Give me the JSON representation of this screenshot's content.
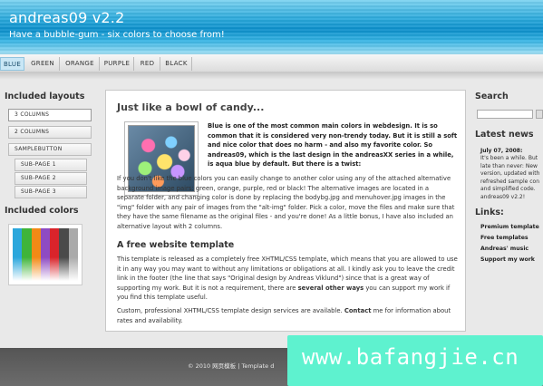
{
  "header": {
    "title": "andreas09 v2.2",
    "slogan": "Have a bubble-gum - six colors to choose from!"
  },
  "color_tabs": [
    "BLUE",
    "GREEN",
    "ORANGE",
    "PURPLE",
    "RED",
    "BLACK"
  ],
  "active_tab": "BLUE",
  "left": {
    "layouts_heading": "Included layouts",
    "nav": [
      "3 COLUMNS",
      "2 COLUMNS",
      "SAMPLEBUTTON",
      "SUB-PAGE 1",
      "SUB-PAGE 2",
      "SUB-PAGE 3"
    ],
    "colors_heading": "Included colors",
    "swatch_colors": [
      "#2ba7dc",
      "#3fb43a",
      "#f28a16",
      "#8e4bc2",
      "#d9242b",
      "#4a4a4a",
      "#aaaaaa"
    ]
  },
  "content": {
    "heading": "Just like a bowl of candy...",
    "intro": "Blue is one of the most common main colors in webdesign. It is so common that it is considered very non-trendy today. But it is still a soft and nice color that does no harm - and also my favorite color. So andreas09, which is the last design in the andreasXX series in a while, is aqua blue by default. But there is a twist:",
    "para1": "If you don't like the blue colors you can easily change to another color using any of the attached alternative background image pairs: green, orange, purple, red or black! The alternative images are located in a separate folder, and changing color is done by replacing the bodybg.jpg and menuhover.jpg images in the \"img\" folder with any pair of images from the \"alt-img\" folder. Pick a color, move the files and make sure that they have the same filename as the original files - and you're done! As a little bonus, I have also included an alternative layout with 2 columns.",
    "subheading": "A free website template",
    "para2a": "This template is released as a completely free XHTML/CSS template, which means that you are allowed to use it in any way you may want to without any limitations or obligations at all. I kindly ask you to leave the credit link in the footer (the line that says \"Original design by Andreas Viklund\") since that is a great way of supporting my work. But it is not a requirement, there are ",
    "para2_bold": "several other ways",
    "para2b": " you can support my work if you find this template useful.",
    "para3a": "Custom, professional XHTML/CSS template design services are available. ",
    "para3_bold": "Contact",
    "para3b": " me for information about rates and availability."
  },
  "right": {
    "search_heading": "Search",
    "news_heading": "Latest news",
    "news_date": "July 07, 2008:",
    "news_lines": [
      "It's been a while. But",
      "late than never: New",
      "version, updated with",
      "refreshed sample con",
      "and simplified code.",
      "andreas09 v2.2!"
    ],
    "links_heading": "Links:",
    "links": [
      "Premium template",
      "Free templates",
      "Andreas' music",
      "Support my work"
    ]
  },
  "footer": {
    "text": "© 2010 网页模板  | Template d"
  },
  "watermark": {
    "text": "www.bafangjie.cn"
  }
}
